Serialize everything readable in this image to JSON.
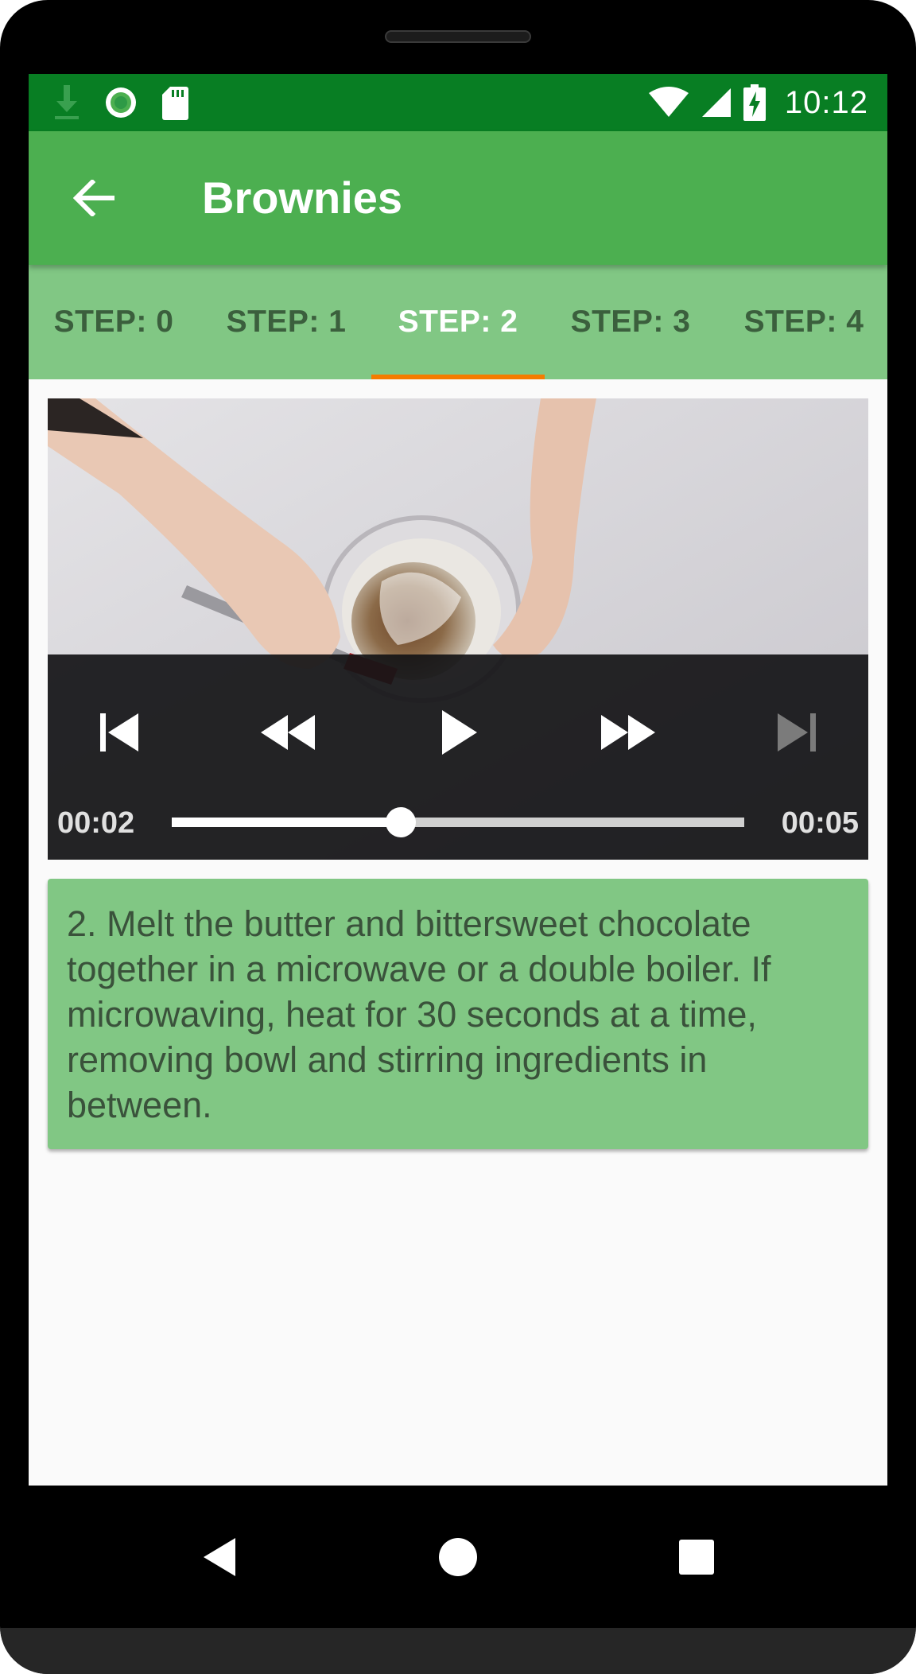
{
  "app": {
    "title": "Brownies"
  },
  "status_bar": {
    "time": "10:12",
    "icons": [
      "download-icon",
      "sync-icon",
      "sd-card-icon",
      "wifi-icon",
      "signal-icon",
      "battery-charging-icon"
    ]
  },
  "tabs": [
    {
      "label": "STEP: 0",
      "selected": false
    },
    {
      "label": "STEP: 1",
      "selected": false
    },
    {
      "label": "STEP: 2",
      "selected": true
    },
    {
      "label": "STEP: 3",
      "selected": false
    },
    {
      "label": "STEP: 4",
      "selected": false
    }
  ],
  "player": {
    "position": "00:02",
    "duration": "00:05",
    "progress_fraction": 0.4,
    "controls": [
      "skip-previous-icon",
      "rewind-icon",
      "play-icon",
      "fast-forward-icon",
      "skip-next-icon"
    ]
  },
  "step": {
    "description": "2. Melt the butter and bittersweet chocolate together in a microwave or a double boiler. If microwaving, heat for 30 seconds at a time, removing bowl and stirring ingredients in between."
  },
  "nav_bar": {
    "buttons": [
      "back-triangle-icon",
      "home-circle-icon",
      "recents-square-icon"
    ]
  },
  "colors": {
    "status_bar": "#087e23",
    "app_bar": "#4caf50",
    "tab_bar": "#81c784",
    "tab_indicator": "#f57c00",
    "card": "#81c784"
  }
}
